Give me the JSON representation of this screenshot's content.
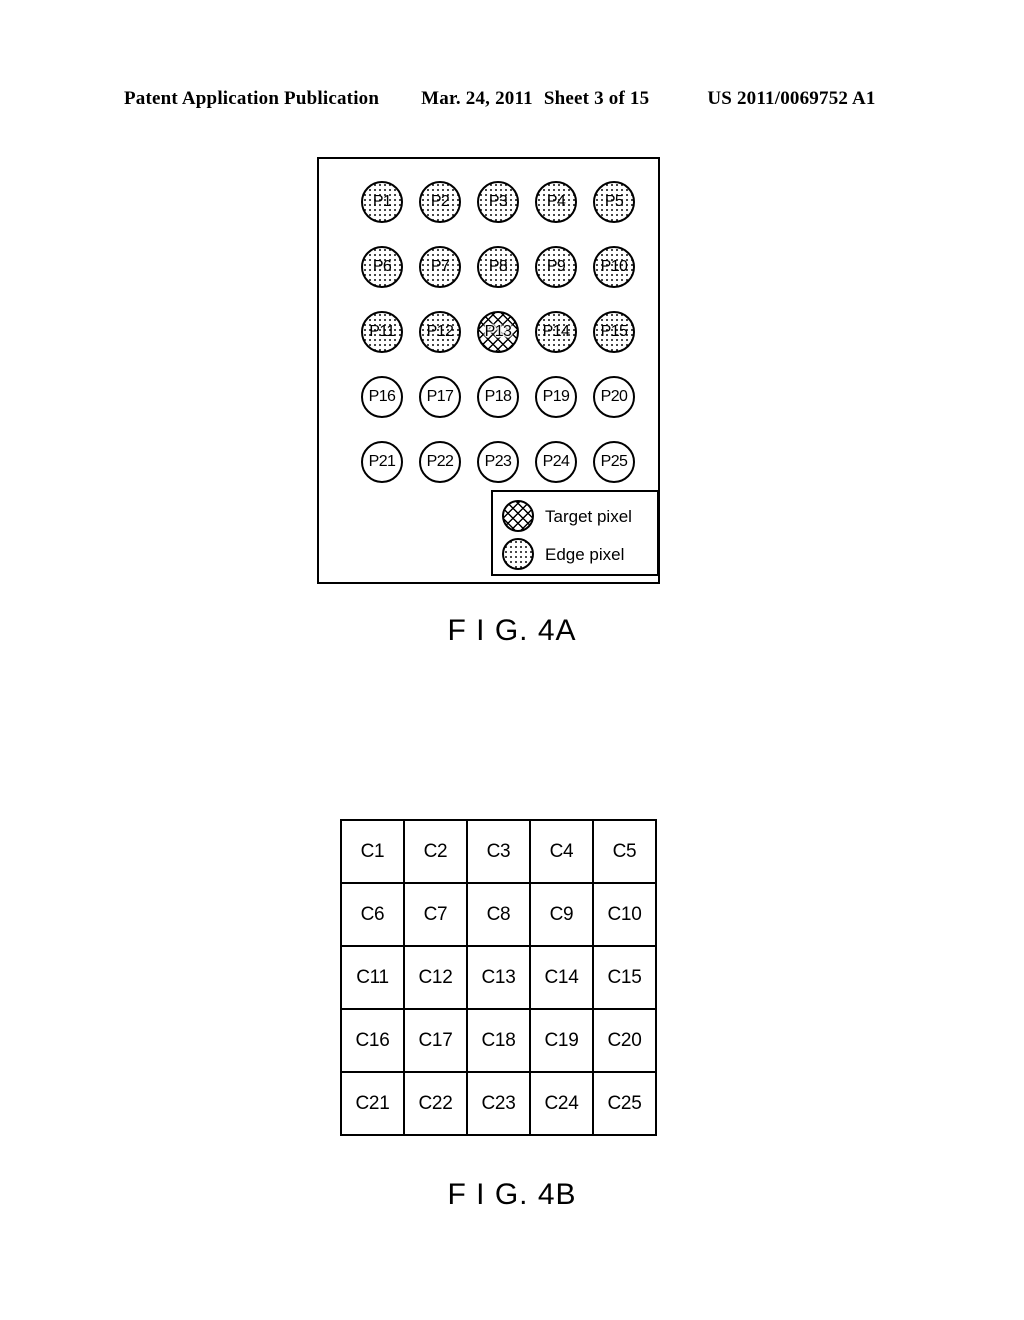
{
  "header": {
    "publication": "Patent Application Publication",
    "date": "Mar. 24, 2011",
    "sheet": "Sheet 3 of 15",
    "patent_number": "US 2011/0069752 A1"
  },
  "figures": [
    {
      "id": "fig4a",
      "caption": "F I G. 4A",
      "type": "pixel-neighborhood-diagram",
      "grid": {
        "rows": 5,
        "cols": 5,
        "cells": [
          [
            {
              "label": "P1",
              "fill": "edge"
            },
            {
              "label": "P2",
              "fill": "edge"
            },
            {
              "label": "P3",
              "fill": "edge"
            },
            {
              "label": "P4",
              "fill": "edge"
            },
            {
              "label": "P5",
              "fill": "edge"
            }
          ],
          [
            {
              "label": "P6",
              "fill": "edge"
            },
            {
              "label": "P7",
              "fill": "edge"
            },
            {
              "label": "P8",
              "fill": "edge"
            },
            {
              "label": "P9",
              "fill": "edge"
            },
            {
              "label": "P10",
              "fill": "edge"
            }
          ],
          [
            {
              "label": "P11",
              "fill": "edge"
            },
            {
              "label": "P12",
              "fill": "edge"
            },
            {
              "label": "P13",
              "fill": "target"
            },
            {
              "label": "P14",
              "fill": "edge"
            },
            {
              "label": "P15",
              "fill": "edge"
            }
          ],
          [
            {
              "label": "P16",
              "fill": "none"
            },
            {
              "label": "P17",
              "fill": "none"
            },
            {
              "label": "P18",
              "fill": "none"
            },
            {
              "label": "P19",
              "fill": "none"
            },
            {
              "label": "P20",
              "fill": "none"
            }
          ],
          [
            {
              "label": "P21",
              "fill": "none"
            },
            {
              "label": "P22",
              "fill": "none"
            },
            {
              "label": "P23",
              "fill": "none"
            },
            {
              "label": "P24",
              "fill": "none"
            },
            {
              "label": "P25",
              "fill": "none"
            }
          ]
        ]
      },
      "legend": [
        {
          "label": "Target pixel",
          "fill": "target"
        },
        {
          "label": "Edge pixel",
          "fill": "edge"
        }
      ]
    },
    {
      "id": "fig4b",
      "caption": "F I G. 4B",
      "type": "coefficient-table",
      "grid": {
        "rows": 5,
        "cols": 5,
        "cells": [
          [
            "C1",
            "C2",
            "C3",
            "C4",
            "C5"
          ],
          [
            "C6",
            "C7",
            "C8",
            "C9",
            "C10"
          ],
          [
            "C11",
            "C12",
            "C13",
            "C14",
            "C15"
          ],
          [
            "C16",
            "C17",
            "C18",
            "C19",
            "C20"
          ],
          [
            "C21",
            "C22",
            "C23",
            "C24",
            "C25"
          ]
        ]
      }
    }
  ],
  "colors": {
    "ink": "#000000",
    "paper": "#ffffff"
  }
}
